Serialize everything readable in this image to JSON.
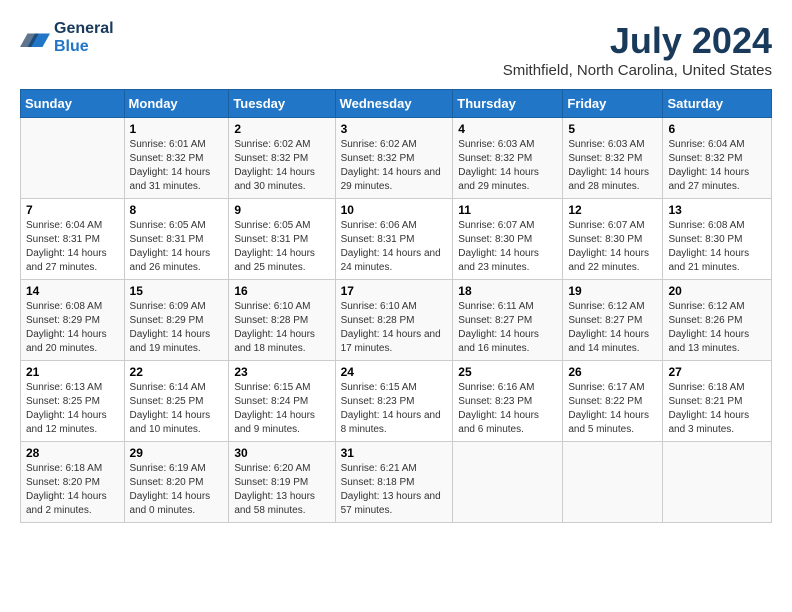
{
  "logo": {
    "line1": "General",
    "line2": "Blue"
  },
  "title": "July 2024",
  "subtitle": "Smithfield, North Carolina, United States",
  "weekdays": [
    "Sunday",
    "Monday",
    "Tuesday",
    "Wednesday",
    "Thursday",
    "Friday",
    "Saturday"
  ],
  "weeks": [
    [
      {
        "day": "",
        "sunrise": "",
        "sunset": "",
        "daylight": ""
      },
      {
        "day": "1",
        "sunrise": "Sunrise: 6:01 AM",
        "sunset": "Sunset: 8:32 PM",
        "daylight": "Daylight: 14 hours and 31 minutes."
      },
      {
        "day": "2",
        "sunrise": "Sunrise: 6:02 AM",
        "sunset": "Sunset: 8:32 PM",
        "daylight": "Daylight: 14 hours and 30 minutes."
      },
      {
        "day": "3",
        "sunrise": "Sunrise: 6:02 AM",
        "sunset": "Sunset: 8:32 PM",
        "daylight": "Daylight: 14 hours and 29 minutes."
      },
      {
        "day": "4",
        "sunrise": "Sunrise: 6:03 AM",
        "sunset": "Sunset: 8:32 PM",
        "daylight": "Daylight: 14 hours and 29 minutes."
      },
      {
        "day": "5",
        "sunrise": "Sunrise: 6:03 AM",
        "sunset": "Sunset: 8:32 PM",
        "daylight": "Daylight: 14 hours and 28 minutes."
      },
      {
        "day": "6",
        "sunrise": "Sunrise: 6:04 AM",
        "sunset": "Sunset: 8:32 PM",
        "daylight": "Daylight: 14 hours and 27 minutes."
      }
    ],
    [
      {
        "day": "7",
        "sunrise": "Sunrise: 6:04 AM",
        "sunset": "Sunset: 8:31 PM",
        "daylight": "Daylight: 14 hours and 27 minutes."
      },
      {
        "day": "8",
        "sunrise": "Sunrise: 6:05 AM",
        "sunset": "Sunset: 8:31 PM",
        "daylight": "Daylight: 14 hours and 26 minutes."
      },
      {
        "day": "9",
        "sunrise": "Sunrise: 6:05 AM",
        "sunset": "Sunset: 8:31 PM",
        "daylight": "Daylight: 14 hours and 25 minutes."
      },
      {
        "day": "10",
        "sunrise": "Sunrise: 6:06 AM",
        "sunset": "Sunset: 8:31 PM",
        "daylight": "Daylight: 14 hours and 24 minutes."
      },
      {
        "day": "11",
        "sunrise": "Sunrise: 6:07 AM",
        "sunset": "Sunset: 8:30 PM",
        "daylight": "Daylight: 14 hours and 23 minutes."
      },
      {
        "day": "12",
        "sunrise": "Sunrise: 6:07 AM",
        "sunset": "Sunset: 8:30 PM",
        "daylight": "Daylight: 14 hours and 22 minutes."
      },
      {
        "day": "13",
        "sunrise": "Sunrise: 6:08 AM",
        "sunset": "Sunset: 8:30 PM",
        "daylight": "Daylight: 14 hours and 21 minutes."
      }
    ],
    [
      {
        "day": "14",
        "sunrise": "Sunrise: 6:08 AM",
        "sunset": "Sunset: 8:29 PM",
        "daylight": "Daylight: 14 hours and 20 minutes."
      },
      {
        "day": "15",
        "sunrise": "Sunrise: 6:09 AM",
        "sunset": "Sunset: 8:29 PM",
        "daylight": "Daylight: 14 hours and 19 minutes."
      },
      {
        "day": "16",
        "sunrise": "Sunrise: 6:10 AM",
        "sunset": "Sunset: 8:28 PM",
        "daylight": "Daylight: 14 hours and 18 minutes."
      },
      {
        "day": "17",
        "sunrise": "Sunrise: 6:10 AM",
        "sunset": "Sunset: 8:28 PM",
        "daylight": "Daylight: 14 hours and 17 minutes."
      },
      {
        "day": "18",
        "sunrise": "Sunrise: 6:11 AM",
        "sunset": "Sunset: 8:27 PM",
        "daylight": "Daylight: 14 hours and 16 minutes."
      },
      {
        "day": "19",
        "sunrise": "Sunrise: 6:12 AM",
        "sunset": "Sunset: 8:27 PM",
        "daylight": "Daylight: 14 hours and 14 minutes."
      },
      {
        "day": "20",
        "sunrise": "Sunrise: 6:12 AM",
        "sunset": "Sunset: 8:26 PM",
        "daylight": "Daylight: 14 hours and 13 minutes."
      }
    ],
    [
      {
        "day": "21",
        "sunrise": "Sunrise: 6:13 AM",
        "sunset": "Sunset: 8:25 PM",
        "daylight": "Daylight: 14 hours and 12 minutes."
      },
      {
        "day": "22",
        "sunrise": "Sunrise: 6:14 AM",
        "sunset": "Sunset: 8:25 PM",
        "daylight": "Daylight: 14 hours and 10 minutes."
      },
      {
        "day": "23",
        "sunrise": "Sunrise: 6:15 AM",
        "sunset": "Sunset: 8:24 PM",
        "daylight": "Daylight: 14 hours and 9 minutes."
      },
      {
        "day": "24",
        "sunrise": "Sunrise: 6:15 AM",
        "sunset": "Sunset: 8:23 PM",
        "daylight": "Daylight: 14 hours and 8 minutes."
      },
      {
        "day": "25",
        "sunrise": "Sunrise: 6:16 AM",
        "sunset": "Sunset: 8:23 PM",
        "daylight": "Daylight: 14 hours and 6 minutes."
      },
      {
        "day": "26",
        "sunrise": "Sunrise: 6:17 AM",
        "sunset": "Sunset: 8:22 PM",
        "daylight": "Daylight: 14 hours and 5 minutes."
      },
      {
        "day": "27",
        "sunrise": "Sunrise: 6:18 AM",
        "sunset": "Sunset: 8:21 PM",
        "daylight": "Daylight: 14 hours and 3 minutes."
      }
    ],
    [
      {
        "day": "28",
        "sunrise": "Sunrise: 6:18 AM",
        "sunset": "Sunset: 8:20 PM",
        "daylight": "Daylight: 14 hours and 2 minutes."
      },
      {
        "day": "29",
        "sunrise": "Sunrise: 6:19 AM",
        "sunset": "Sunset: 8:20 PM",
        "daylight": "Daylight: 14 hours and 0 minutes."
      },
      {
        "day": "30",
        "sunrise": "Sunrise: 6:20 AM",
        "sunset": "Sunset: 8:19 PM",
        "daylight": "Daylight: 13 hours and 58 minutes."
      },
      {
        "day": "31",
        "sunrise": "Sunrise: 6:21 AM",
        "sunset": "Sunset: 8:18 PM",
        "daylight": "Daylight: 13 hours and 57 minutes."
      },
      {
        "day": "",
        "sunrise": "",
        "sunset": "",
        "daylight": ""
      },
      {
        "day": "",
        "sunrise": "",
        "sunset": "",
        "daylight": ""
      },
      {
        "day": "",
        "sunrise": "",
        "sunset": "",
        "daylight": ""
      }
    ]
  ]
}
